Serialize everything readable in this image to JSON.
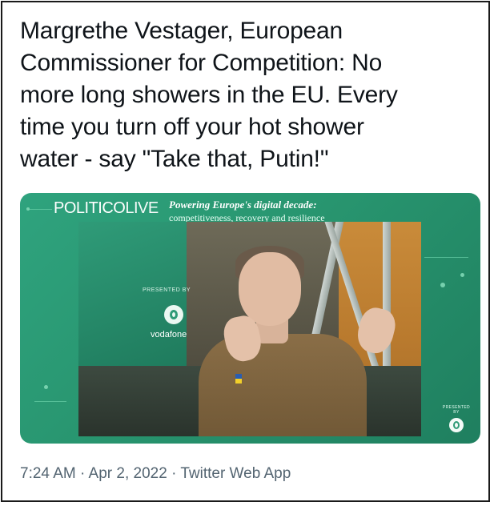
{
  "tweet": {
    "lines": [
      "Margrethe Vestager, European",
      "Commissioner for Competition: No",
      "more long showers in the EU. Every",
      "time you turn off your hot shower",
      "water - say \"Take that, Putin!\""
    ],
    "meta": "7:24 AM · Apr 2, 2022 · Twitter Web App"
  },
  "media": {
    "brand_main": "POLITICO",
    "brand_live": "LIVE",
    "tagline": "Powering Europe's digital decade:",
    "subtagline": "competitiveness, recovery and resilience",
    "presented_by": "PRESENTED BY",
    "sponsor": "vodafone",
    "corner_presented_by": "PRESENTED BY"
  },
  "colors": {
    "accent_green": "#2fa37e",
    "text_primary": "#0f1419",
    "text_secondary": "#536471"
  }
}
